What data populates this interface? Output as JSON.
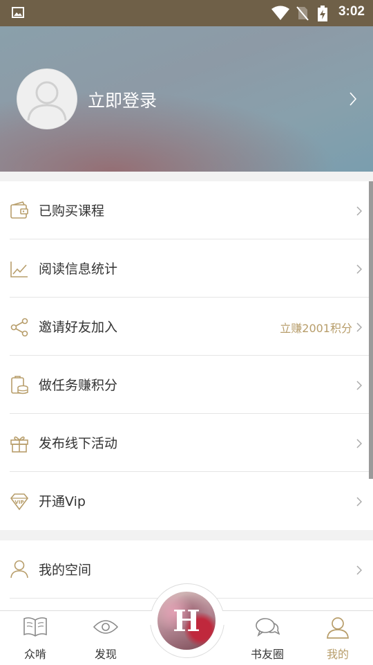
{
  "status_bar": {
    "time": "3:02"
  },
  "header": {
    "login_label": "立即登录"
  },
  "menu": [
    {
      "label": "已购买课程",
      "icon": "wallet-icon"
    },
    {
      "label": "阅读信息统计",
      "icon": "line-chart-icon"
    },
    {
      "label": "邀请好友加入",
      "icon": "share-icon",
      "extra": "立赚2001积分"
    },
    {
      "label": "做任务赚积分",
      "icon": "task-coins-icon"
    },
    {
      "label": "发布线下活动",
      "icon": "gift-icon"
    },
    {
      "label": "开通Vip",
      "icon": "vip-diamond-icon"
    }
  ],
  "menu2": [
    {
      "label": "我的空间",
      "icon": "person-icon"
    }
  ],
  "nav": {
    "items": [
      {
        "label": "众啃",
        "icon": "book-icon"
      },
      {
        "label": "发现",
        "icon": "eye-icon"
      },
      {
        "label": "书友圈",
        "icon": "chat-bubbles-icon"
      },
      {
        "label": "我的",
        "icon": "person-icon",
        "active": true
      }
    ],
    "center_letter": "H"
  },
  "colors": {
    "accent": "#b79d6a",
    "status_bar": "#6f6048"
  }
}
